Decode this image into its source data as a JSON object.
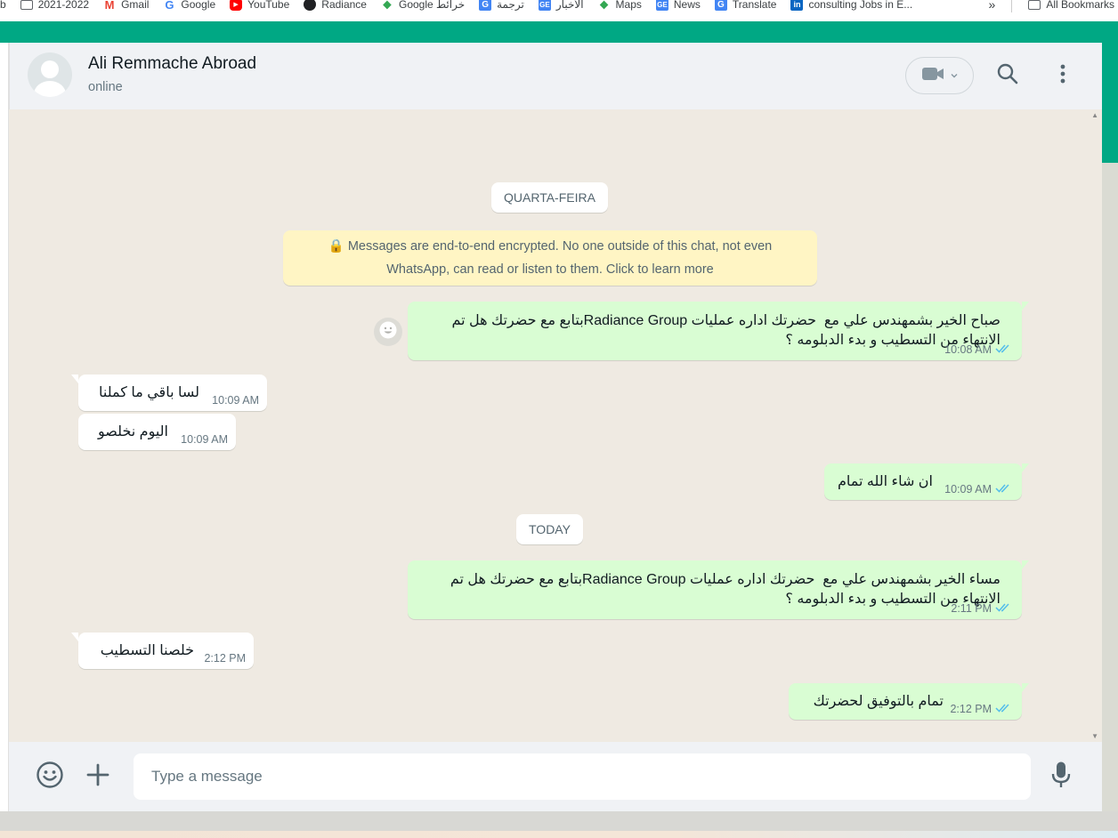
{
  "bookmarks": [
    {
      "label": "b",
      "icon": "folder-icon"
    },
    {
      "label": "2021-2022",
      "icon": "folder-icon"
    },
    {
      "label": "Gmail",
      "icon": "gmail-icon"
    },
    {
      "label": "Google",
      "icon": "google-icon"
    },
    {
      "label": "YouTube",
      "icon": "youtube-icon"
    },
    {
      "label": "Radiance",
      "icon": "globe-icon"
    },
    {
      "label": "Google خرائط",
      "icon": "maps-icon"
    },
    {
      "label": "ترجمة",
      "icon": "translate-icon"
    },
    {
      "label": "الأخبار",
      "icon": "news-icon"
    },
    {
      "label": "Maps",
      "icon": "maps-icon"
    },
    {
      "label": "News",
      "icon": "news-icon"
    },
    {
      "label": "Translate",
      "icon": "translate-icon"
    },
    {
      "label": "consulting Jobs in E...",
      "icon": "linkedin-icon"
    }
  ],
  "bookmarks_more": "»",
  "all_bookmarks": "All Bookmarks",
  "header": {
    "name": "Ali Remmache Abroad",
    "status": "online"
  },
  "encryption_note": "🔒 Messages are end-to-end encrypted. No one outside of this chat, not even WhatsApp, can read or listen to them. Click to learn more",
  "dates": {
    "first": "QUARTA-FEIRA",
    "second": "TODAY"
  },
  "messages": [
    {
      "dir": "out",
      "text": "صباح الخير بشمهندس علي مع  حضرتك اداره عمليات Radiance Groupبتابع مع حضرتك هل تم الانتهاء من التسطيب و بدء الدبلومه ؟",
      "time": "10:08 AM"
    },
    {
      "dir": "in",
      "text": "لسا باقي ما كملنا",
      "time": "10:09 AM"
    },
    {
      "dir": "in",
      "text": "اليوم نخلصو",
      "time": "10:09 AM"
    },
    {
      "dir": "out",
      "text": "ان شاء الله تمام",
      "time": "10:09 AM"
    },
    {
      "dir": "out",
      "text": "مساء الخير بشمهندس علي مع  حضرتك اداره عمليات Radiance Groupبتابع مع حضرتك هل تم الانتهاء من التسطيب و بدء الدبلومه ؟",
      "time": "2:11 PM"
    },
    {
      "dir": "in",
      "text": "خلصنا التسطيب",
      "time": "2:12 PM"
    },
    {
      "dir": "out",
      "text": "تمام بالتوفيق لحضرتك",
      "time": "2:12 PM"
    }
  ],
  "composer": {
    "placeholder": "Type a message"
  },
  "colors": {
    "accent": "#00a884",
    "outgoing_bubble": "#d9fdd3",
    "incoming_bubble": "#ffffff",
    "read_ticks": "#53bdeb",
    "system_note": "#fff5c4"
  }
}
